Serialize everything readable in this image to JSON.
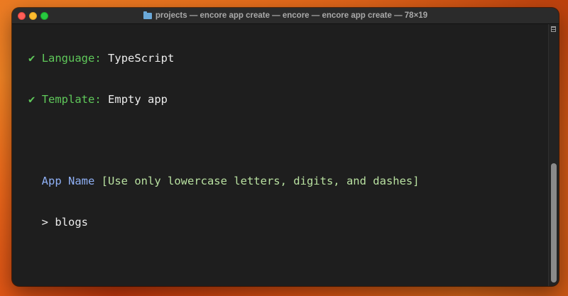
{
  "window": {
    "title": "projects — encore app create — encore — encore app create — 78×19"
  },
  "terminal": {
    "lines": [
      {
        "check": "✔",
        "label": "Language:",
        "value": "TypeScript"
      },
      {
        "check": "✔",
        "label": "Template:",
        "value": "Empty app"
      }
    ],
    "prompt": {
      "label": "App Name",
      "hint": "[Use only lowercase letters, digits, and dashes]",
      "caret": ">",
      "input": "blogs"
    }
  },
  "colors": {
    "check": "#5fc85a",
    "prompt_label": "#8fb0f5",
    "hint": "#b8e0a0",
    "text": "#ececec",
    "background": "#1e1e1e"
  }
}
